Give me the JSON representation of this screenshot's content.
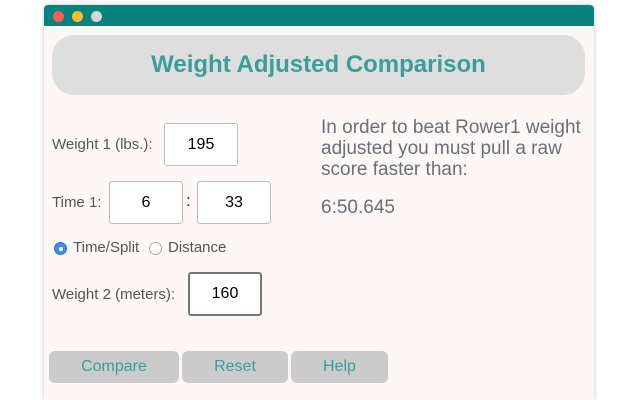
{
  "header": {
    "title": "Weight Adjusted Comparison"
  },
  "form": {
    "weight1_label": "Weight 1 (lbs.):",
    "weight1_value": "195",
    "time1_label": "Time 1:",
    "time1_minutes": "6",
    "time_separator": ":",
    "time1_seconds": "33",
    "mode_options": [
      "Time/Split",
      "Distance"
    ],
    "mode_selected": "Time/Split",
    "weight2_label": "Weight 2 (meters):",
    "weight2_value": "160"
  },
  "result": {
    "message": "In order to beat Rower1 weight adjusted you must pull a raw score faster than:",
    "value": "6:50.645"
  },
  "buttons": {
    "compare": "Compare",
    "reset": "Reset",
    "help": "Help"
  },
  "colors": {
    "titlebar": "#06837e",
    "accent": "#3a9e9a",
    "header_bg": "#dedede",
    "button_bg": "#cbcbcb",
    "window_bg": "#fdf7f6"
  }
}
